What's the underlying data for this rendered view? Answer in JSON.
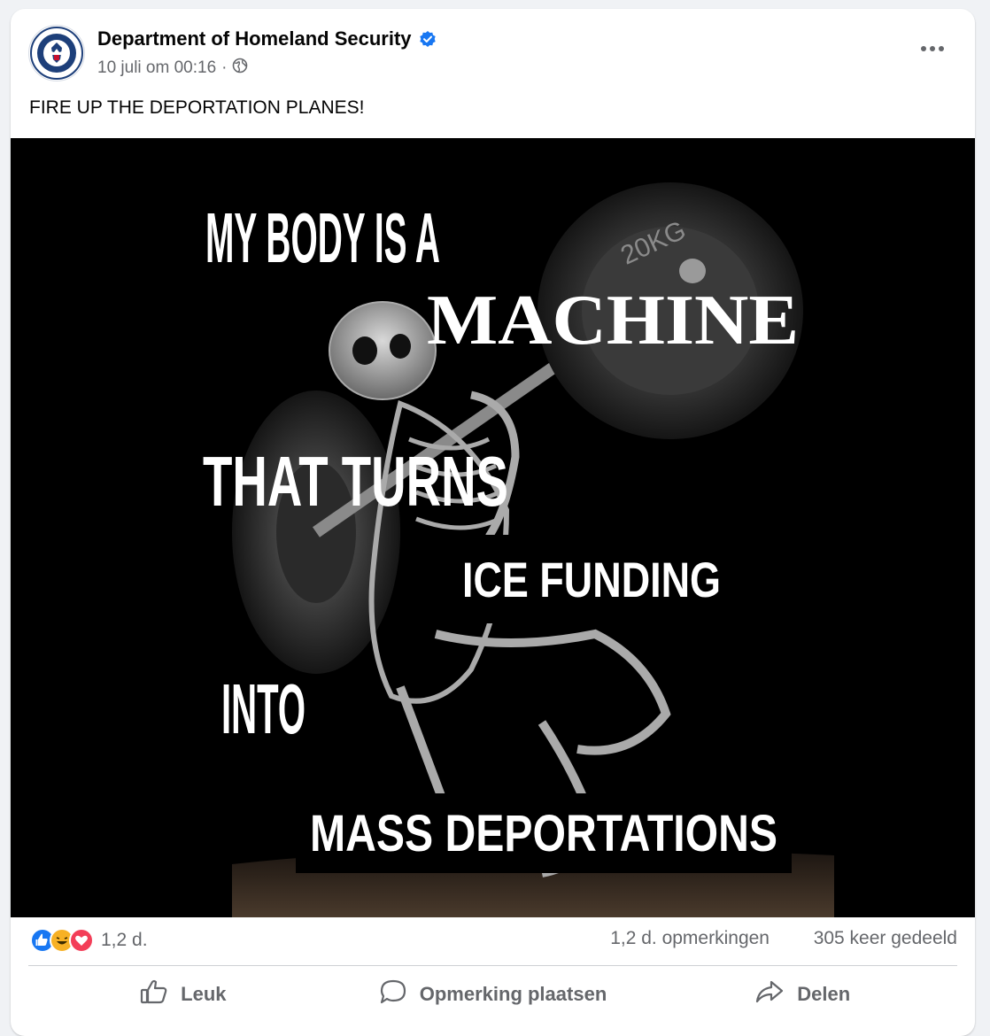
{
  "post": {
    "author": "Department of Homeland Security",
    "timestamp": "10 juli om 00:16",
    "separator": "·",
    "text": "FIRE UP THE DEPORTATION PLANES!"
  },
  "meme": {
    "line1": "MY BODY IS A",
    "line2": "MACHINE",
    "line3": "THAT TURNS",
    "line4": "ICE FUNDING",
    "line5": "INTO",
    "line6": "MASS DEPORTATIONS",
    "plate_text": "20KG"
  },
  "stats": {
    "reaction_count": "1,2 d.",
    "comments": "1,2 d. opmerkingen",
    "shares": "305 keer gedeeld"
  },
  "actions": {
    "like": "Leuk",
    "comment": "Opmerking plaatsen",
    "share": "Delen"
  },
  "colors": {
    "verified": "#1877f2",
    "like": "#1877f2",
    "love": "#f33e58",
    "haha": "#f7b125"
  },
  "icons": {
    "avatar": "dhs-seal-icon",
    "verified": "verified-badge-icon",
    "audience": "globe-icon",
    "more": "more-options-icon",
    "like_action": "thumbs-up-icon",
    "comment_action": "comment-bubble-icon",
    "share_action": "share-arrow-icon"
  }
}
